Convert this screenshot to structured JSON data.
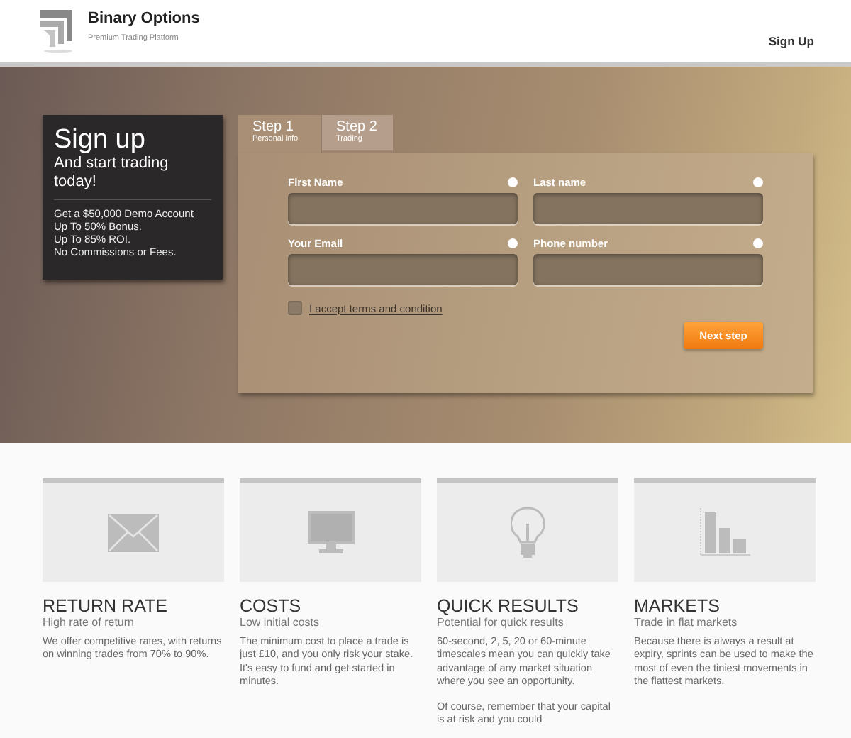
{
  "header": {
    "brand": "Binary Options",
    "tagline": "Premium Trading Platform",
    "nav_link": "Sign Up"
  },
  "promo": {
    "title": "Sign up",
    "subtitle": "And start trading today!",
    "benefits": [
      "Get a $50,000 Demo Account",
      "Up To 50% Bonus.",
      "Up To 85% ROI.",
      "No Commissions or Fees."
    ]
  },
  "steps": [
    {
      "label": "Step 1",
      "caption": "Personal info",
      "selected": true
    },
    {
      "label": "Step 2",
      "caption": "Trading",
      "selected": false
    }
  ],
  "form": {
    "fields": [
      {
        "label": "First Name"
      },
      {
        "label": "Last name"
      },
      {
        "label": "Your Email"
      },
      {
        "label": "Phone number"
      }
    ],
    "terms": {
      "label": "I accept terms and condition",
      "checked": false
    },
    "submit": "Next step"
  },
  "features": [
    {
      "kind": "envelope",
      "title": "RETURN RATE",
      "subtitle": "High rate of return",
      "paragraphs": [
        "We offer competitive rates, with returns on winning trades from 70% to 90%."
      ]
    },
    {
      "kind": "monitor",
      "title": "COSTS",
      "subtitle": "Low initial costs",
      "paragraphs": [
        "The minimum cost to place a trade is just £10, and you only risk your stake. It's easy to fund and get started in minutes."
      ]
    },
    {
      "kind": "bulb",
      "title": "QUICK RESULTS",
      "subtitle": "Potential for quick results",
      "paragraphs": [
        "60-second, 2, 5, 20 or 60-minute timescales mean you can quickly take advantage of any market situation where you see an opportunity.",
        "Of course, remember that your capital is at risk and you could"
      ]
    },
    {
      "kind": "chart",
      "title": "MARKETS",
      "subtitle": "Trade in flat markets",
      "paragraphs": [
        "Because there is always a result at expiry, sprints can be used to make the most of even the tiniest movements in the flattest markets."
      ]
    }
  ]
}
